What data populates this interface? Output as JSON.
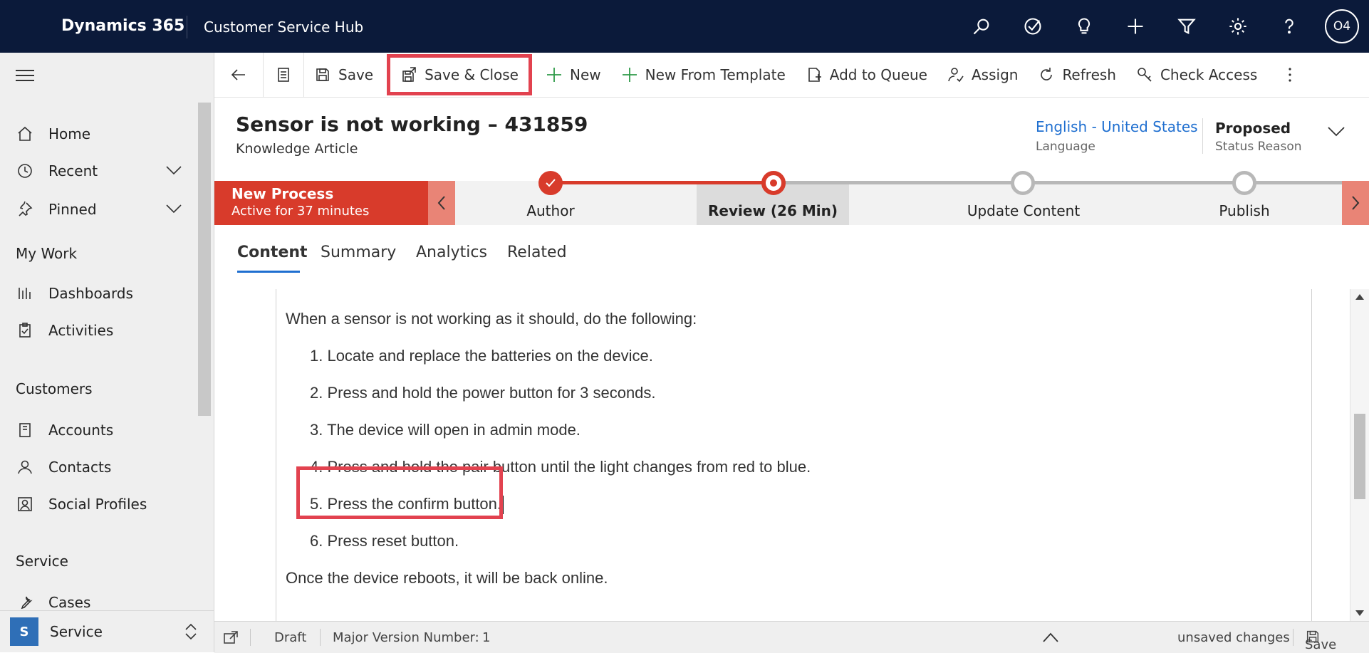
{
  "topbar": {
    "brand": "Dynamics 365",
    "app_name": "Customer Service Hub",
    "icons": [
      "search-icon",
      "assistant-icon",
      "lightbulb-icon",
      "plus-icon",
      "filter-icon",
      "gear-icon",
      "help-icon"
    ],
    "user_initials": "O4"
  },
  "sidebar": {
    "items": [
      {
        "label": "Home",
        "icon": "home-icon"
      },
      {
        "label": "Recent",
        "icon": "clock-icon"
      },
      {
        "label": "Pinned",
        "icon": "pin-icon"
      }
    ],
    "groups": [
      {
        "title": "My Work",
        "items": [
          {
            "label": "Dashboards",
            "icon": "dashboard-icon"
          },
          {
            "label": "Activities",
            "icon": "clipboard-icon"
          }
        ]
      },
      {
        "title": "Customers",
        "items": [
          {
            "label": "Accounts",
            "icon": "building-icon"
          },
          {
            "label": "Contacts",
            "icon": "person-icon"
          },
          {
            "label": "Social Profiles",
            "icon": "social-profile-icon"
          }
        ]
      },
      {
        "title": "Service",
        "items": [
          {
            "label": "Cases",
            "icon": "wrench-icon"
          }
        ]
      }
    ],
    "area": {
      "badge": "S",
      "label": "Service"
    }
  },
  "commandbar": {
    "save": "Save",
    "save_close": "Save & Close",
    "new": "New",
    "new_from_template": "New From Template",
    "add_to_queue": "Add to Queue",
    "assign": "Assign",
    "refresh": "Refresh",
    "check_access": "Check Access"
  },
  "header": {
    "title": "Sensor is not working – 431859",
    "entity": "Knowledge Article",
    "language_value": "English - United States",
    "language_label": "Language",
    "status_value": "Proposed",
    "status_label": "Status Reason"
  },
  "process": {
    "name": "New Process",
    "duration": "Active for 37 minutes",
    "stages": [
      "Author",
      "Review  (26 Min)",
      "Update Content",
      "Publish"
    ],
    "accent_color": "#d83b2b"
  },
  "tabs": [
    "Content",
    "Summary",
    "Analytics",
    "Related"
  ],
  "article": {
    "intro": "When a sensor is not working as it should, do the following:",
    "steps": [
      "1. Locate and replace the batteries on the device.",
      "2. Press and hold the power button for 3 seconds.",
      "3. The device will open in admin mode.",
      "4. Press and hold the pair button until the light changes from red to blue.",
      "5. Press the confirm button.",
      "6. Press reset button."
    ],
    "outro": "Once the device reboots, it will be back online."
  },
  "footer": {
    "status": "Draft",
    "version_label": "Major Version Number:",
    "version_value": "1",
    "unsaved": "unsaved changes",
    "save": "Save"
  },
  "highlight_color": "#e2424f"
}
